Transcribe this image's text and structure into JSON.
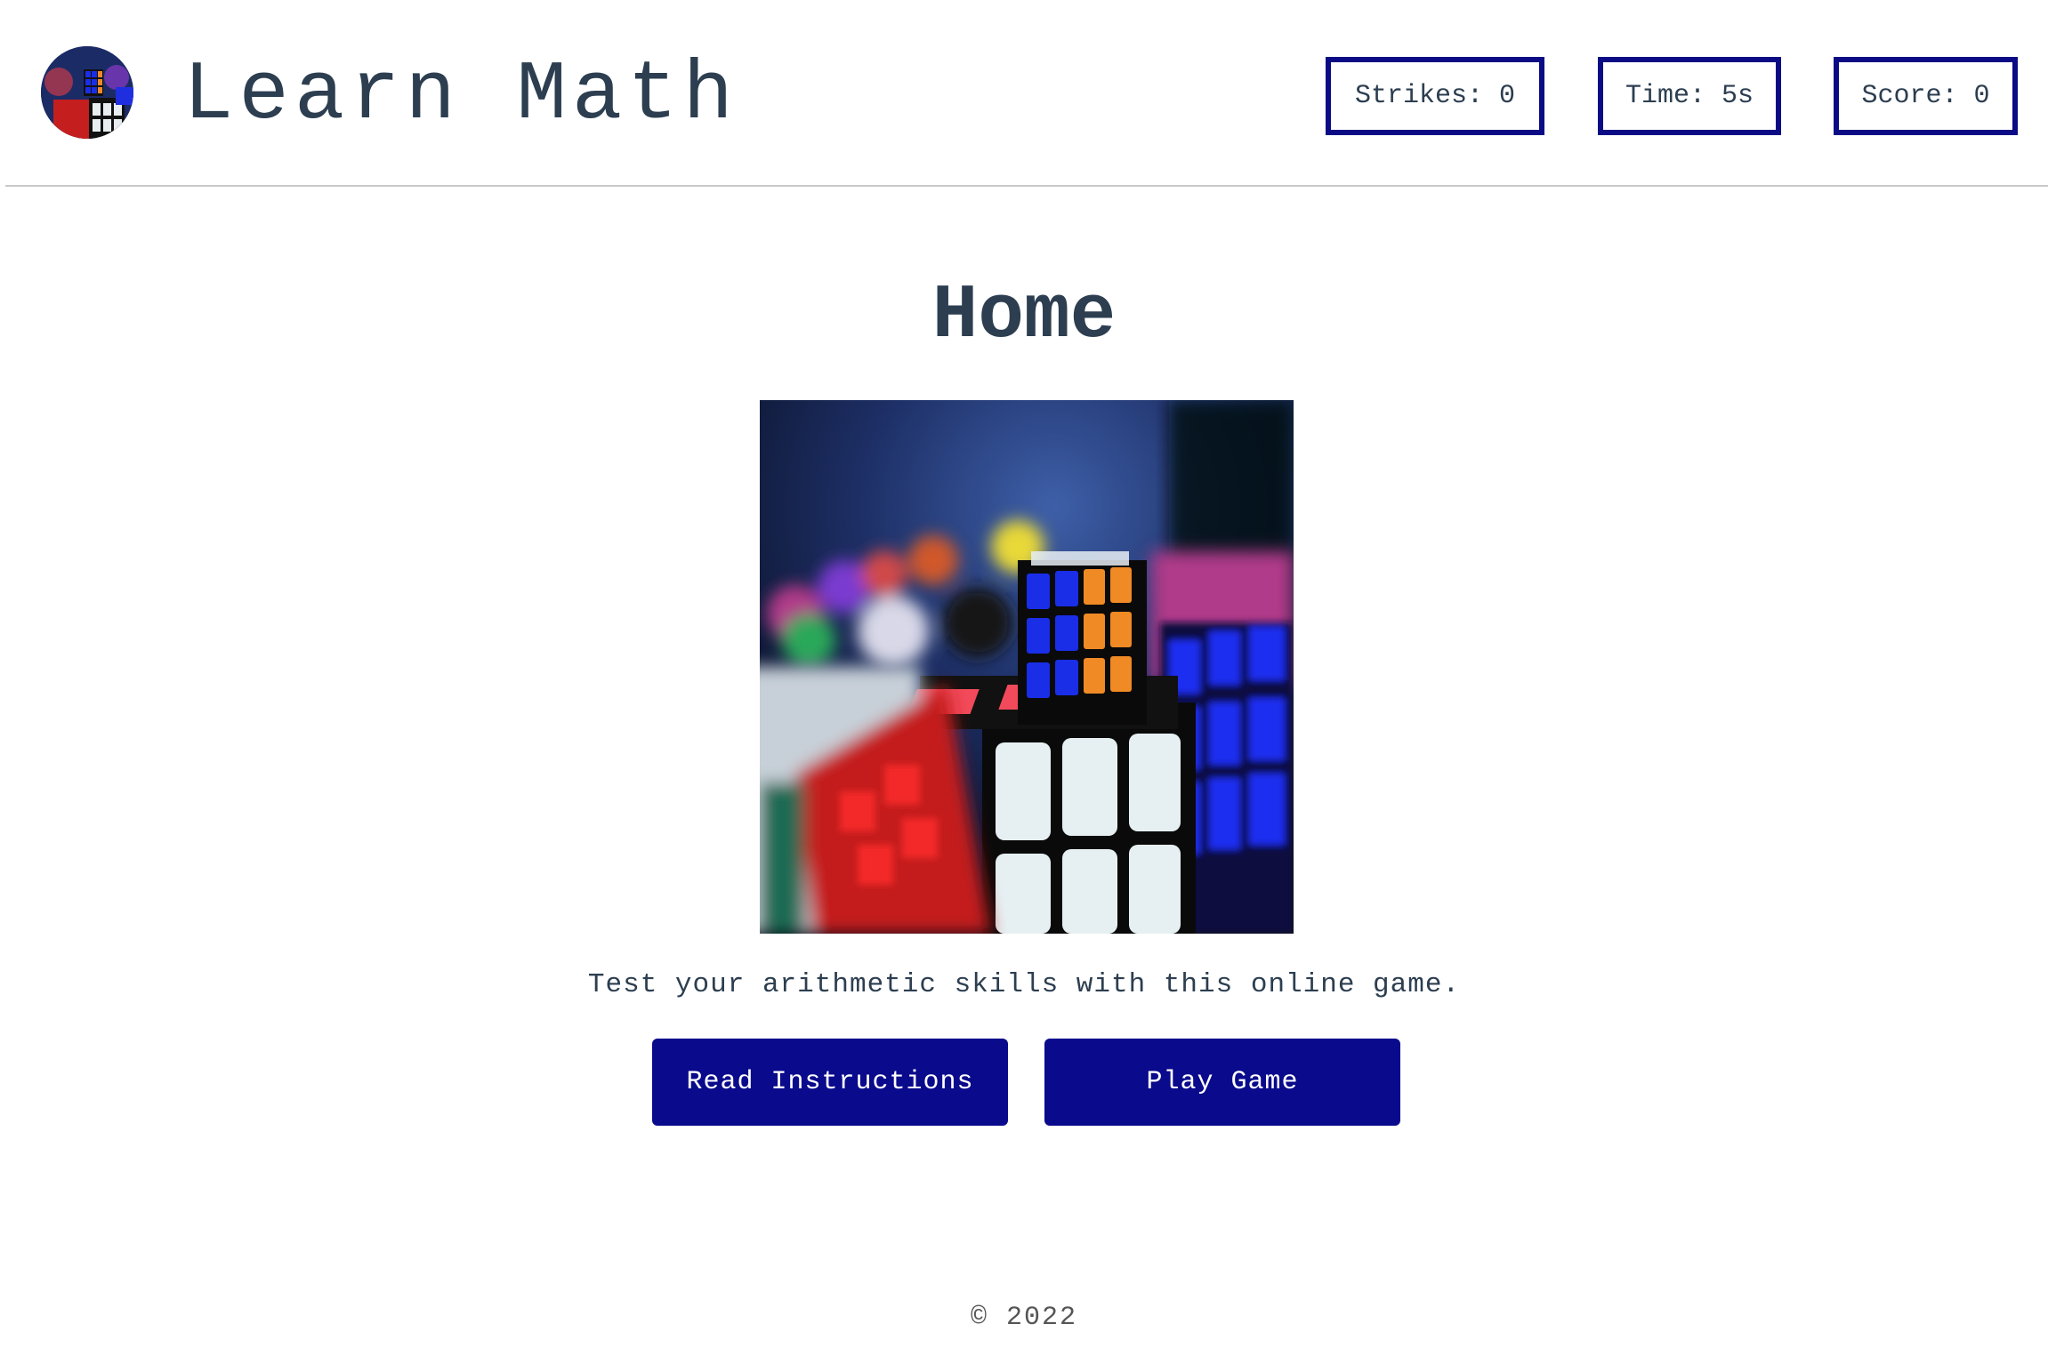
{
  "header": {
    "title": "Learn Math",
    "logo_icon": "rubiks-cube-logo-icon",
    "stats": {
      "strikes": "Strikes: 0",
      "time": "Time: 5s",
      "score": "Score: 0"
    }
  },
  "main": {
    "heading": "Home",
    "hero_image_icon": "rubiks-cubes-photo",
    "tagline": "Test your arithmetic skills with this online game.",
    "buttons": {
      "instructions": "Read Instructions",
      "play": "Play Game"
    }
  },
  "footer": {
    "copyright": "© 2022"
  },
  "colors": {
    "accent": "#0a0a8c",
    "text": "#2c3e50",
    "divider": "#c8c8c8"
  }
}
